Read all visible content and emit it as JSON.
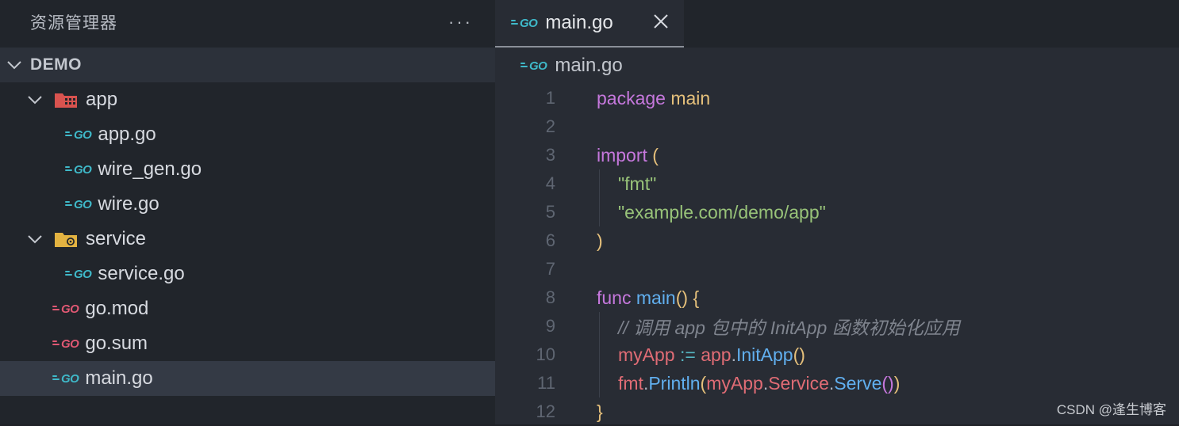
{
  "sidebar": {
    "title": "资源管理器",
    "more": "···",
    "section": "DEMO",
    "items": [
      {
        "label": "app",
        "kind": "folder",
        "icon": "folder-app-icon",
        "depth": 1,
        "expanded": true
      },
      {
        "label": "app.go",
        "kind": "file",
        "icon": "go-file-icon",
        "depth": 2
      },
      {
        "label": "wire_gen.go",
        "kind": "file",
        "icon": "go-file-icon",
        "depth": 2
      },
      {
        "label": "wire.go",
        "kind": "file",
        "icon": "go-file-icon",
        "depth": 2
      },
      {
        "label": "service",
        "kind": "folder",
        "icon": "folder-service-icon",
        "depth": 1,
        "expanded": true
      },
      {
        "label": "service.go",
        "kind": "file",
        "icon": "go-file-icon",
        "depth": 2
      },
      {
        "label": "go.mod",
        "kind": "file",
        "icon": "go-mod-icon",
        "depth": 1
      },
      {
        "label": "go.sum",
        "kind": "file",
        "icon": "go-mod-icon",
        "depth": 1
      },
      {
        "label": "main.go",
        "kind": "file",
        "icon": "go-file-icon",
        "depth": 1,
        "selected": true
      }
    ]
  },
  "editor": {
    "tab_label": "main.go",
    "breadcrumb": "main.go",
    "go_icon_text": "GO",
    "lines": [
      {
        "n": "1"
      },
      {
        "n": "2"
      },
      {
        "n": "3"
      },
      {
        "n": "4"
      },
      {
        "n": "5"
      },
      {
        "n": "6"
      },
      {
        "n": "7"
      },
      {
        "n": "8"
      },
      {
        "n": "9"
      },
      {
        "n": "10"
      },
      {
        "n": "11"
      },
      {
        "n": "12"
      }
    ],
    "code": {
      "l1_kw": "package",
      "l1_name": "main",
      "l3_kw": "import",
      "l3_paren": "(",
      "l4_str": "\"fmt\"",
      "l5_str": "\"example.com/demo/app\"",
      "l6_paren": ")",
      "l8_kw": "func",
      "l8_fn": "main",
      "l8_parens": "()",
      "l8_brace": "{",
      "l9_cmt": "// 调用 app 包中的 InitApp 函数初始化应用",
      "l10_var": "myApp",
      "l10_op": ":=",
      "l10_pkg": "app",
      "l10_dot": ".",
      "l10_fn": "InitApp",
      "l10_parens": "()",
      "l11_pkg": "fmt",
      "l11_dot1": ".",
      "l11_fn": "Println",
      "l11_open": "(",
      "l11_var": "myApp",
      "l11_dot2": ".",
      "l11_field": "Service",
      "l11_dot3": ".",
      "l11_method": "Serve",
      "l11_call": "()",
      "l11_close": ")",
      "l12_brace": "}"
    }
  },
  "watermark": "CSDN @逢生博客",
  "colors": {
    "go_blue": "#3fb9c9",
    "go_red": "#e05873",
    "keyword": "#c678dd",
    "string": "#98c379",
    "function": "#61afef",
    "variable": "#e06c75",
    "yellow": "#e5c07b"
  }
}
